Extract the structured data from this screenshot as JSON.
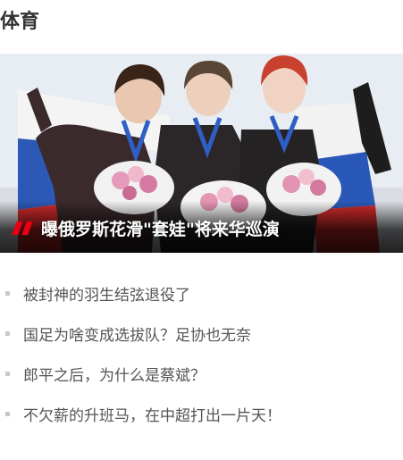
{
  "section": {
    "title": "体育"
  },
  "hero": {
    "headline": "曝俄罗斯花滑\"套娃\"将来华巡演"
  },
  "news": [
    {
      "text": "被封神的羽生结弦退役了"
    },
    {
      "text": "国足为啥变成选拔队？足协也无奈"
    },
    {
      "text": "郎平之后，为什么是蔡斌？"
    },
    {
      "text": "不欠薪的升班马，在中超打出一片天！"
    }
  ],
  "colors": {
    "accent": "#e60012",
    "title": "#333333",
    "list_text": "#555555",
    "bullet": "#c8c8c8"
  }
}
